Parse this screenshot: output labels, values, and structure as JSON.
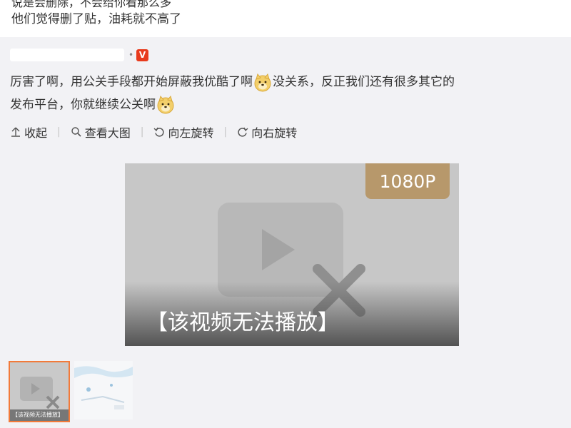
{
  "prev_post": {
    "cut_line": "说是会删除，不会给你看那么多",
    "line": "他们觉得删了贴，油耗就不高了"
  },
  "comment": {
    "username_bullet": "•",
    "verified_badge": "V",
    "text_part1": "厉害了啊，用公关手段都开始屏蔽我优酷了啊",
    "text_part2": "没关系，反正我们还有很多其它的",
    "text_part3": "发布平台，你就继续公关啊",
    "emoji_icon": "doge-emoji-icon"
  },
  "actions": {
    "collapse": "收起",
    "view_large": "查看大图",
    "rotate_left": "向左旋转",
    "rotate_right": "向右旋转",
    "separator": "|"
  },
  "video": {
    "resolution": "1080P",
    "message": "【该视频无法播放】",
    "badge_color": "#b7986b"
  },
  "thumbnails": {
    "thumb1_label": "【该视频无法播放】"
  },
  "colors": {
    "accent_border": "#f27a3a",
    "verified_red": "#e83a1c"
  }
}
